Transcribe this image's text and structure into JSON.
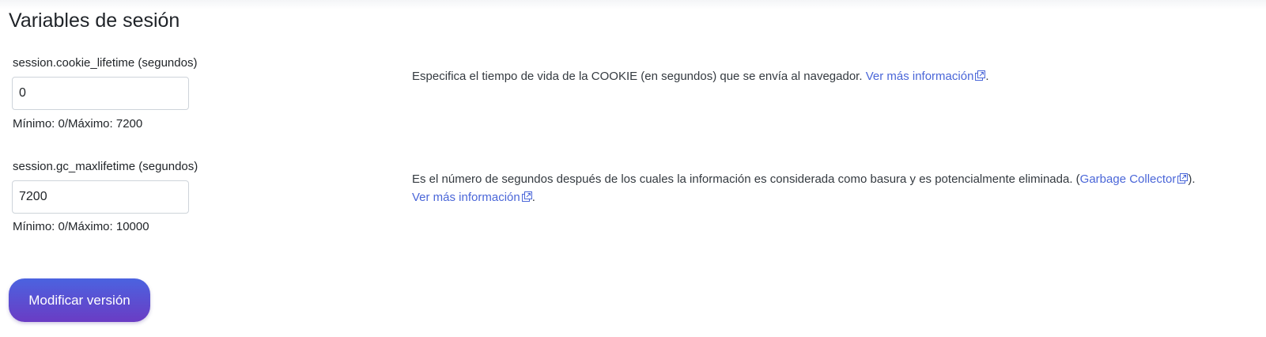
{
  "section": {
    "title": "Variables de sesión"
  },
  "fields": [
    {
      "label": "session.cookie_lifetime (segundos)",
      "value": "0",
      "hint": "Mínimo: 0/Máximo: 7200",
      "description": "Especifica el tiempo de vida de la COOKIE (en segundos) que se envía al navegador. ",
      "link_text": "Ver más información",
      "link_icon": "external-link-icon",
      "after_link": "."
    },
    {
      "label": "session.gc_maxlifetime (segundos)",
      "value": "7200",
      "hint": "Mínimo: 0/Máximo: 10000",
      "description": "Es el número de segundos después de los cuales la información es considerada como basura y es potencialmente eliminada. (",
      "inline_link_text": "Garbage Collector",
      "inline_after": ").",
      "link_text": "Ver más información",
      "link_icon": "external-link-icon",
      "after_link": "."
    }
  ],
  "actions": {
    "submit_label": "Modificar versión"
  },
  "colors": {
    "link": "#4a66d8",
    "button_gradient_start": "#4b63e0",
    "button_gradient_end": "#6a3cc4"
  }
}
